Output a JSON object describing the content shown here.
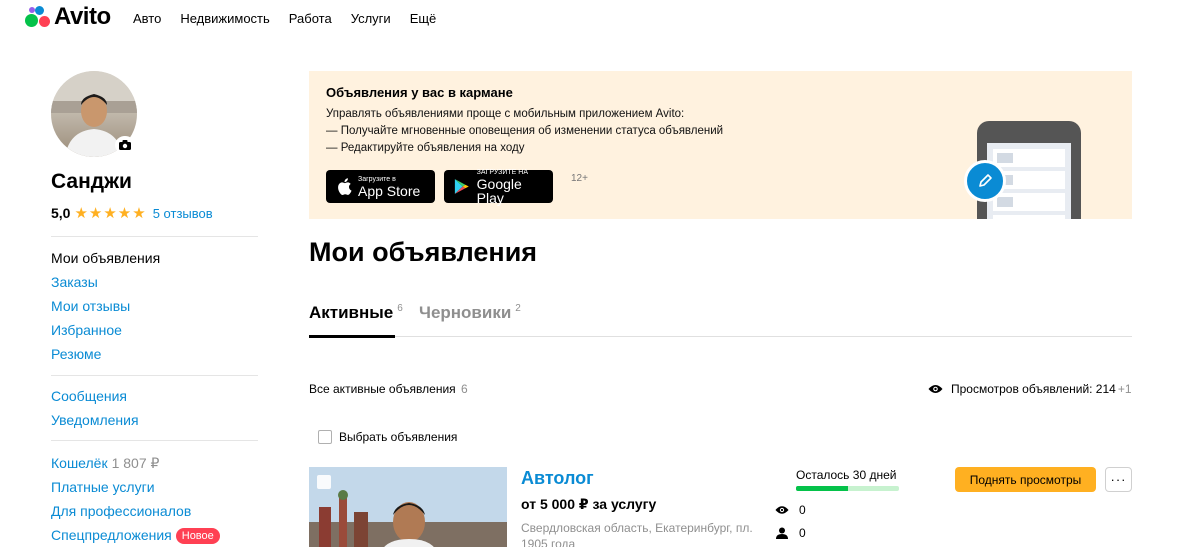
{
  "header": {
    "logo_text": "Avito",
    "nav": [
      "Авто",
      "Недвижимость",
      "Работа",
      "Услуги",
      "Ещё"
    ]
  },
  "profile": {
    "name": "Санджи",
    "rating": "5,0",
    "stars": "★★★★★",
    "reviews": "5 отзывов"
  },
  "sidebar": {
    "group1": [
      "Мои объявления",
      "Заказы",
      "Мои отзывы",
      "Избранное",
      "Резюме"
    ],
    "group2": [
      "Сообщения",
      "Уведомления"
    ],
    "group3": [
      {
        "label": "Кошелёк",
        "extra": "1 807 ₽"
      },
      {
        "label": "Платные услуги"
      },
      {
        "label": "Для профессионалов"
      },
      {
        "label": "Спецпредложения",
        "badge": "Новое"
      }
    ]
  },
  "banner": {
    "title": "Объявления у вас в кармане",
    "lines": [
      "Управлять объявлениями проще с мобильным приложением Avito:",
      "— Получайте мгновенные оповещения об изменении статуса объявлений",
      "— Редактируйте объявления на ходу"
    ],
    "appstore_small": "Загрузите в",
    "appstore_big": "App Store",
    "googleplay_small": "ЗАГРУЗИТЕ НА",
    "googleplay_big": "Google Play",
    "age": "12+"
  },
  "page_title": "Мои объявления",
  "tabs": [
    {
      "label": "Активные",
      "count": "6"
    },
    {
      "label": "Черновики",
      "count": "2"
    }
  ],
  "list": {
    "all_label": "Все активные объявления",
    "all_count": "6",
    "views_label": "Просмотров объявлений: 214",
    "views_plus": "+1",
    "select_label": "Выбрать объявления"
  },
  "item": {
    "title": "Автолог",
    "price": "от 5 000 ₽ за услугу",
    "address": "Свердловская область, Екатеринбург, пл. 1905 года",
    "remaining": "Осталось 30 дней",
    "progress": 0.5,
    "views": "0",
    "contacts": "0",
    "raise_label": "Поднять просмотры",
    "more_label": "···"
  },
  "colors": {
    "accent": "#0a8bd4",
    "primary_button": "#ffb021",
    "progress": "#04c24a",
    "badge": "#ff4053",
    "banner_bg": "#fff2df"
  }
}
